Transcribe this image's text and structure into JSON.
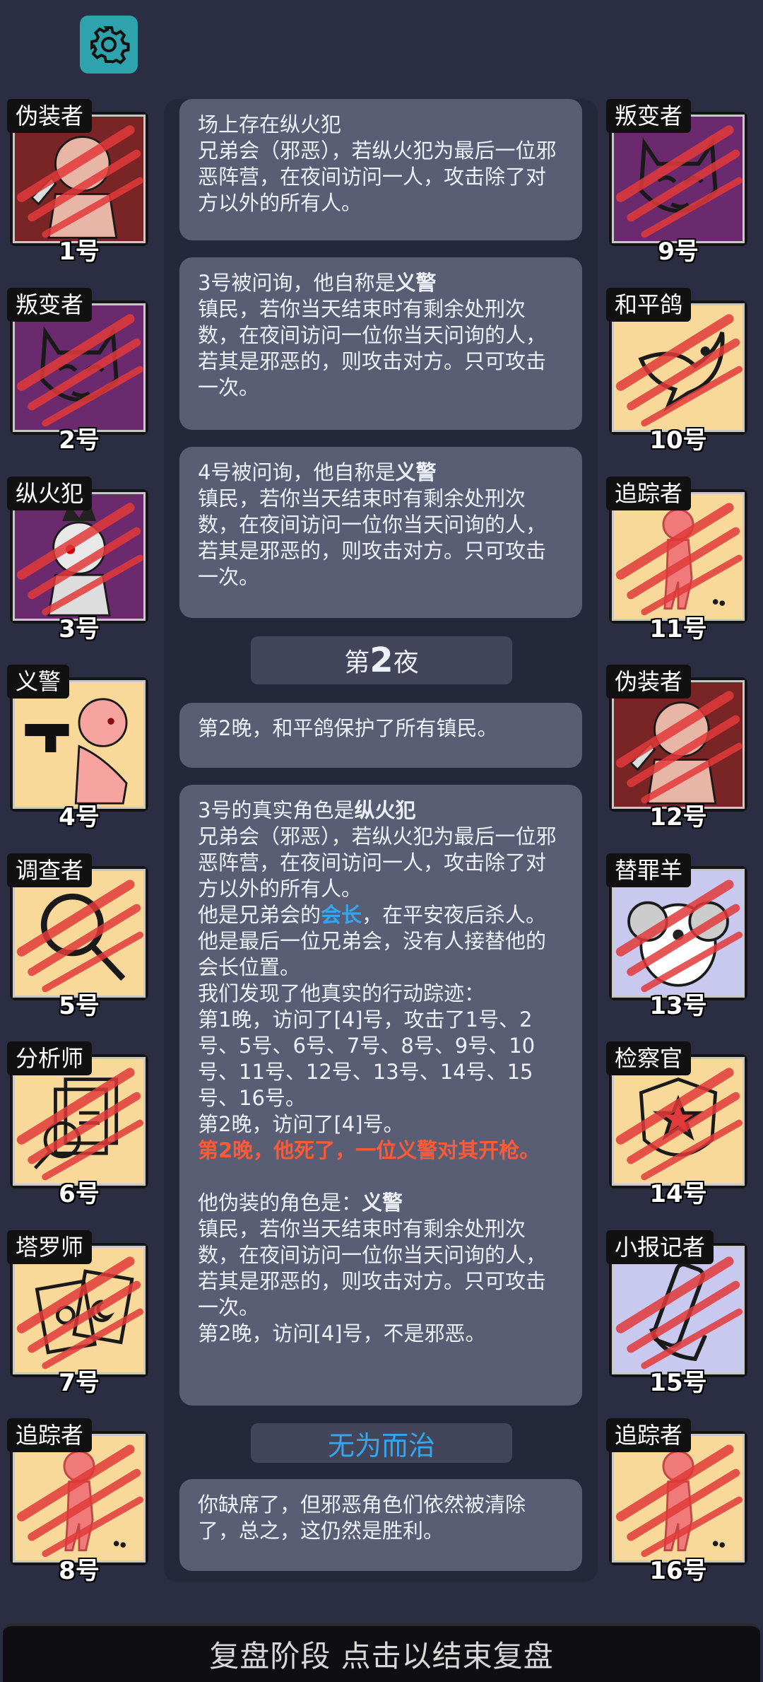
{
  "colors": {
    "bg": "#2b2e42",
    "message_bg": "#5a5e74",
    "accent_blue": "#35a5ee",
    "accent_red": "#ff5a36",
    "gear_bg": "#2fa3ad"
  },
  "toolbar": {
    "settings_icon": "gear-icon"
  },
  "players_left": [
    {
      "role": "伪装者",
      "number": "1号",
      "bg": "#7a2525",
      "icon": "disguiser-portrait-icon",
      "dead": true
    },
    {
      "role": "叛变者",
      "number": "2号",
      "bg": "#6c2a6e",
      "icon": "mask-icon",
      "dead": true
    },
    {
      "role": "纵火犯",
      "number": "3号",
      "bg": "#6c2a6e",
      "icon": "arsonist-portrait-icon",
      "dead": true
    },
    {
      "role": "义警",
      "number": "4号",
      "bg": "#f9d99a",
      "icon": "gun-figure-icon",
      "dead": false
    },
    {
      "role": "调查者",
      "number": "5号",
      "bg": "#f9d99a",
      "icon": "magnifier-icon",
      "dead": true
    },
    {
      "role": "分析师",
      "number": "6号",
      "bg": "#f9d99a",
      "icon": "documents-magnifier-icon",
      "dead": true
    },
    {
      "role": "塔罗师",
      "number": "7号",
      "bg": "#f9d99a",
      "icon": "tarot-cards-icon",
      "dead": true
    },
    {
      "role": "追踪者",
      "number": "8号",
      "bg": "#f9d99a",
      "icon": "tracker-figure-icon",
      "dead": true
    }
  ],
  "players_right": [
    {
      "role": "叛变者",
      "number": "9号",
      "bg": "#6c2a6e",
      "icon": "mask-icon",
      "dead": true
    },
    {
      "role": "和平鸽",
      "number": "10号",
      "bg": "#f9d99a",
      "icon": "dove-icon",
      "dead": true
    },
    {
      "role": "追踪者",
      "number": "11号",
      "bg": "#f9d99a",
      "icon": "tracker-figure-icon",
      "dead": true
    },
    {
      "role": "伪装者",
      "number": "12号",
      "bg": "#7a2525",
      "icon": "disguiser-portrait-icon",
      "dead": true
    },
    {
      "role": "替罪羊",
      "number": "13号",
      "bg": "#c9c8ee",
      "icon": "ram-icon",
      "dead": true
    },
    {
      "role": "检察官",
      "number": "14号",
      "bg": "#f9d99a",
      "icon": "prosecutor-badge-icon",
      "dead": true
    },
    {
      "role": "小报记者",
      "number": "15号",
      "bg": "#c9c8ee",
      "icon": "newspaper-hand-icon",
      "dead": true
    },
    {
      "role": "追踪者",
      "number": "16号",
      "bg": "#f9d99a",
      "icon": "tracker-figure-icon",
      "dead": true
    }
  ],
  "log": {
    "m1": {
      "l1": "场上存在纵火犯",
      "l2": "兄弟会（邪恶），若纵火犯为最后一位邪恶阵营，在夜间访问一人，攻击除了对方以外的所有人。"
    },
    "m2": {
      "pre": "3号被问询，他自称是",
      "role": "义警",
      "desc": "镇民，若你当天结束时有剩余处刑次数，在夜间访问一位你当天问询的人，若其是邪恶的，则攻击对方。只可攻击一次。"
    },
    "m3": {
      "pre": "4号被问询，他自称是",
      "role": "义警",
      "desc": "镇民，若你当天结束时有剩余处刑次数，在夜间访问一位你当天问询的人，若其是邪恶的，则攻击对方。只可攻击一次。"
    },
    "night": {
      "pre": "第",
      "num": "2",
      "post": "夜"
    },
    "m4": "第2晚，和平鸽保护了所有镇民。",
    "m5": {
      "title_pre": "3号的真实角色是",
      "title_role": "纵火犯",
      "desc": "兄弟会（邪恶），若纵火犯为最后一位邪恶阵营，在夜间访问一人，攻击除了对方以外的所有人。",
      "leader_pre": "他是兄弟会的",
      "leader": "会长",
      "leader_post": "，在平安夜后杀人。他是最后一位兄弟会，没有人接替他的会长位置。",
      "trace_intro": "我们发现了他真实的行动踪迹：",
      "night1": "第1晚，访问了[4]号，攻击了1号、2号、5号、6号、7号、8号、9号、10号、11号、12号、13号、14号、15号、16号。",
      "night2": "第2晚，访问了[4]号。",
      "death": "第2晚，他死了，一位义警对其开枪。",
      "disguise_pre": "他伪装的角色是：",
      "disguise_role": "义警",
      "disguise_desc": "镇民，若你当天结束时有剩余处刑次数，在夜间访问一位你当天问询的人，若其是邪恶的，则攻击对方。只可攻击一次。",
      "disguise_visit": "第2晚，访问[4]号，不是邪恶。"
    },
    "result_title": "无为而治",
    "m6": "你缺席了，但邪恶角色们依然被清除了，总之，这仍然是胜利。"
  },
  "bottom_bar": "复盘阶段 点击以结束复盘"
}
